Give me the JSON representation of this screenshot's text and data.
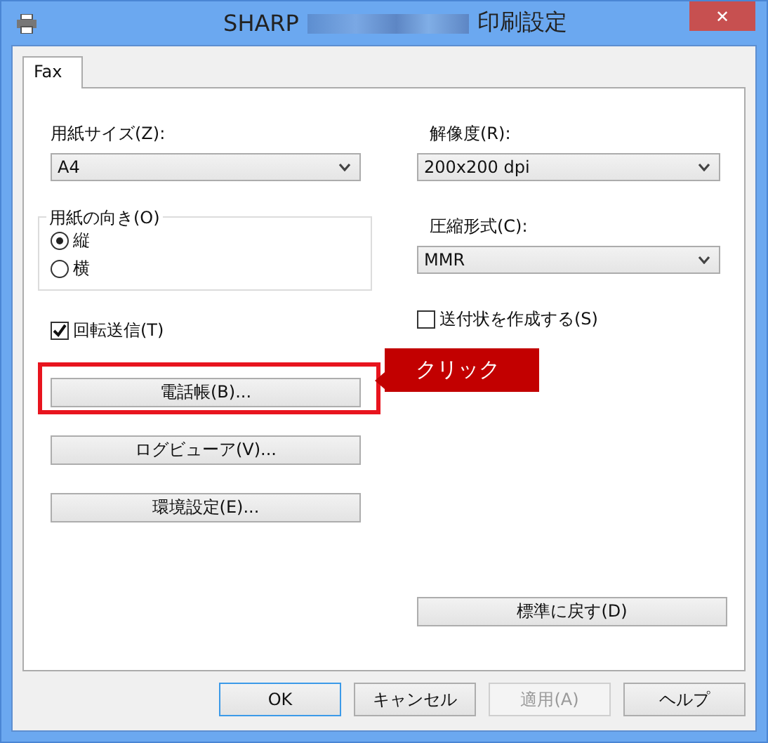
{
  "window": {
    "title_prefix": "SHARP",
    "title_suffix": "印刷設定",
    "close": "✕"
  },
  "tabs": [
    {
      "label": "Fax",
      "selected": true
    }
  ],
  "left": {
    "paper_size": {
      "label": "用紙サイズ(Z):",
      "value": "A4"
    },
    "orientation": {
      "legend": "用紙の向き(O)",
      "options": [
        {
          "label": "縦",
          "selected": true
        },
        {
          "label": "横",
          "selected": false
        }
      ]
    },
    "rotate": {
      "label": "回転送信(T)",
      "checked": true
    },
    "buttons": [
      {
        "label": "電話帳(B)...",
        "highlighted": true
      },
      {
        "label": "ログビューア(V)...",
        "highlighted": false
      },
      {
        "label": "環境設定(E)...",
        "highlighted": false
      }
    ]
  },
  "callout": {
    "text": "クリック"
  },
  "right": {
    "resolution": {
      "label": "解像度(R):",
      "value": "200x200 dpi"
    },
    "compression": {
      "label": "圧縮形式(C):",
      "value": "MMR"
    },
    "cover_sheet": {
      "label": "送付状を作成する(S)",
      "checked": false
    },
    "reset_button": "標準に戻す(D)"
  },
  "dialog_buttons": [
    {
      "label": "OK",
      "default": true,
      "disabled": false
    },
    {
      "label": "キャンセル",
      "default": false,
      "disabled": false
    },
    {
      "label": "適用(A)",
      "default": false,
      "disabled": true
    },
    {
      "label": "ヘルプ",
      "default": false,
      "disabled": false
    }
  ]
}
